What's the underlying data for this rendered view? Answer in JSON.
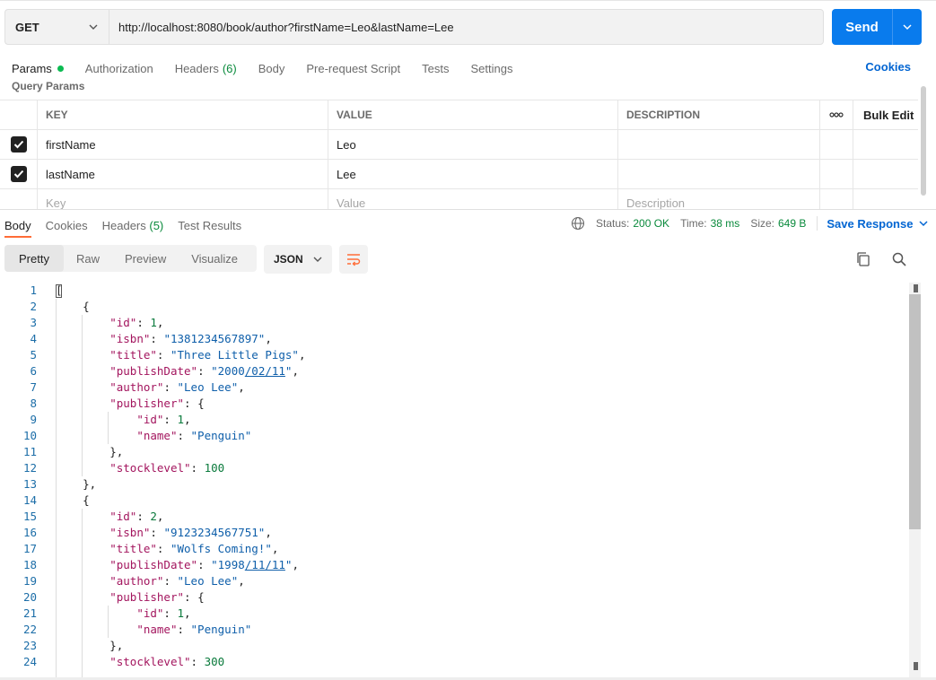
{
  "request": {
    "method": "GET",
    "url": "http://localhost:8080/book/author?firstName=Leo&lastName=Lee",
    "send_label": "Send"
  },
  "request_tabs": {
    "params": "Params",
    "authorization": "Authorization",
    "headers": "Headers",
    "headers_count": "(6)",
    "body": "Body",
    "prerequest": "Pre-request Script",
    "tests": "Tests",
    "settings": "Settings",
    "cookies": "Cookies"
  },
  "query_params": {
    "title": "Query Params",
    "columns": {
      "key": "KEY",
      "value": "VALUE",
      "description": "DESCRIPTION",
      "bulk_edit": "Bulk Edit"
    },
    "rows": [
      {
        "key": "firstName",
        "value": "Leo",
        "checked": true
      },
      {
        "key": "lastName",
        "value": "Lee",
        "checked": true
      }
    ],
    "placeholders": {
      "key": "Key",
      "value": "Value",
      "description": "Description"
    }
  },
  "response_tabs": {
    "body": "Body",
    "cookies": "Cookies",
    "headers": "Headers",
    "headers_count": "(5)",
    "test_results": "Test Results"
  },
  "response_status": {
    "status_label": "Status:",
    "status_value": "200 OK",
    "time_label": "Time:",
    "time_value": "38 ms",
    "size_label": "Size:",
    "size_value": "649 B",
    "save_response": "Save Response"
  },
  "view": {
    "modes": [
      "Pretty",
      "Raw",
      "Preview",
      "Visualize"
    ],
    "active": "Pretty",
    "format": "JSON"
  },
  "code_lines": [
    [
      {
        "t": "["
      }
    ],
    [
      {
        "t": "    {"
      }
    ],
    [
      {
        "t": "        "
      },
      {
        "t": "\"id\"",
        "c": "k"
      },
      {
        "t": ": "
      },
      {
        "t": "1",
        "c": "n"
      },
      {
        "t": ","
      }
    ],
    [
      {
        "t": "        "
      },
      {
        "t": "\"isbn\"",
        "c": "k"
      },
      {
        "t": ": "
      },
      {
        "t": "\"1381234567897\"",
        "c": "s"
      },
      {
        "t": ","
      }
    ],
    [
      {
        "t": "        "
      },
      {
        "t": "\"title\"",
        "c": "k"
      },
      {
        "t": ": "
      },
      {
        "t": "\"Three Little Pigs\"",
        "c": "s"
      },
      {
        "t": ","
      }
    ],
    [
      {
        "t": "        "
      },
      {
        "t": "\"publishDate\"",
        "c": "k"
      },
      {
        "t": ": "
      },
      {
        "t": "\"2000",
        "c": "s"
      },
      {
        "t": "/02/11",
        "c": "s u"
      },
      {
        "t": "\"",
        "c": "s"
      },
      {
        "t": ","
      }
    ],
    [
      {
        "t": "        "
      },
      {
        "t": "\"author\"",
        "c": "k"
      },
      {
        "t": ": "
      },
      {
        "t": "\"Leo Lee\"",
        "c": "s"
      },
      {
        "t": ","
      }
    ],
    [
      {
        "t": "        "
      },
      {
        "t": "\"publisher\"",
        "c": "k"
      },
      {
        "t": ": {"
      }
    ],
    [
      {
        "t": "            "
      },
      {
        "t": "\"id\"",
        "c": "k"
      },
      {
        "t": ": "
      },
      {
        "t": "1",
        "c": "n"
      },
      {
        "t": ","
      }
    ],
    [
      {
        "t": "            "
      },
      {
        "t": "\"name\"",
        "c": "k"
      },
      {
        "t": ": "
      },
      {
        "t": "\"Penguin\"",
        "c": "s"
      }
    ],
    [
      {
        "t": "        },"
      }
    ],
    [
      {
        "t": "        "
      },
      {
        "t": "\"stocklevel\"",
        "c": "k"
      },
      {
        "t": ": "
      },
      {
        "t": "100",
        "c": "n"
      }
    ],
    [
      {
        "t": "    },"
      }
    ],
    [
      {
        "t": "    {"
      }
    ],
    [
      {
        "t": "        "
      },
      {
        "t": "\"id\"",
        "c": "k"
      },
      {
        "t": ": "
      },
      {
        "t": "2",
        "c": "n"
      },
      {
        "t": ","
      }
    ],
    [
      {
        "t": "        "
      },
      {
        "t": "\"isbn\"",
        "c": "k"
      },
      {
        "t": ": "
      },
      {
        "t": "\"9123234567751\"",
        "c": "s"
      },
      {
        "t": ","
      }
    ],
    [
      {
        "t": "        "
      },
      {
        "t": "\"title\"",
        "c": "k"
      },
      {
        "t": ": "
      },
      {
        "t": "\"Wolfs Coming!\"",
        "c": "s"
      },
      {
        "t": ","
      }
    ],
    [
      {
        "t": "        "
      },
      {
        "t": "\"publishDate\"",
        "c": "k"
      },
      {
        "t": ": "
      },
      {
        "t": "\"1998",
        "c": "s"
      },
      {
        "t": "/11/11",
        "c": "s u"
      },
      {
        "t": "\"",
        "c": "s"
      },
      {
        "t": ","
      }
    ],
    [
      {
        "t": "        "
      },
      {
        "t": "\"author\"",
        "c": "k"
      },
      {
        "t": ": "
      },
      {
        "t": "\"Leo Lee\"",
        "c": "s"
      },
      {
        "t": ","
      }
    ],
    [
      {
        "t": "        "
      },
      {
        "t": "\"publisher\"",
        "c": "k"
      },
      {
        "t": ": {"
      }
    ],
    [
      {
        "t": "            "
      },
      {
        "t": "\"id\"",
        "c": "k"
      },
      {
        "t": ": "
      },
      {
        "t": "1",
        "c": "n"
      },
      {
        "t": ","
      }
    ],
    [
      {
        "t": "            "
      },
      {
        "t": "\"name\"",
        "c": "k"
      },
      {
        "t": ": "
      },
      {
        "t": "\"Penguin\"",
        "c": "s"
      }
    ],
    [
      {
        "t": "        },"
      }
    ],
    [
      {
        "t": "        "
      },
      {
        "t": "\"stocklevel\"",
        "c": "k"
      },
      {
        "t": ": "
      },
      {
        "t": "300",
        "c": "n"
      }
    ]
  ],
  "colors": {
    "accent_blue": "#097bed",
    "link_blue": "#0265d2",
    "success_green": "#0a8a3c",
    "tab_underline": "#ff6c37"
  }
}
